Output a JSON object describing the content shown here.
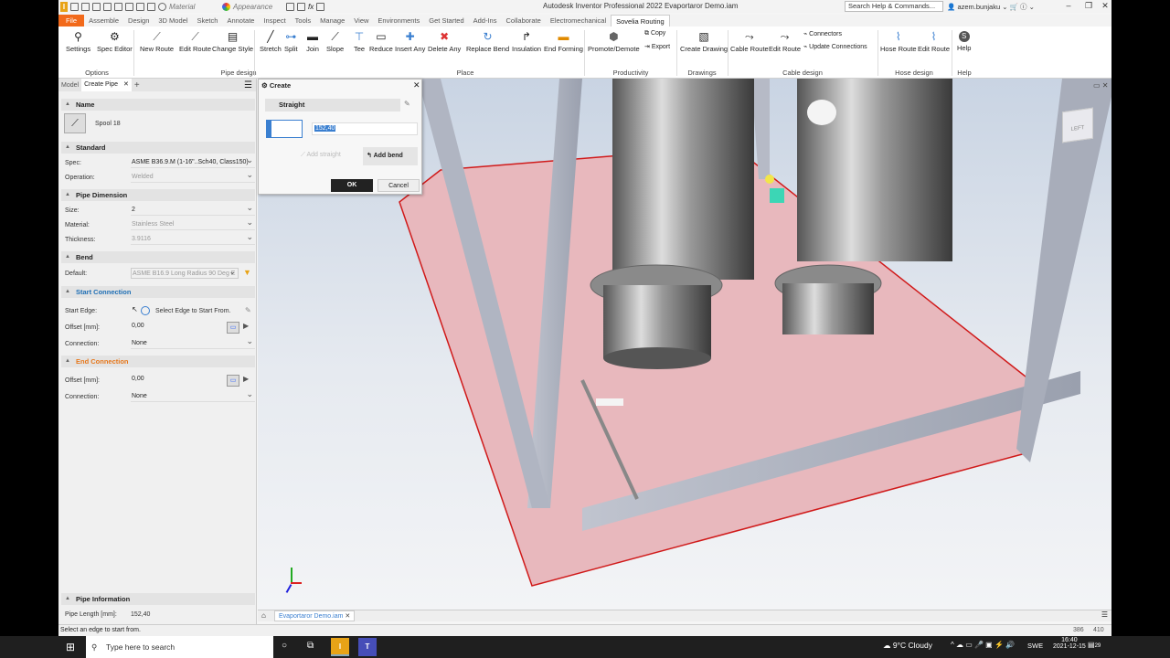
{
  "titlebar": {
    "material": "Material",
    "appearance": "Appearance",
    "title": "Autodesk Inventor Professional 2022   Evaportaror Demo.iam",
    "search_placeholder": "Search Help & Commands...",
    "user": "azem.bunjaku"
  },
  "menu_tabs": [
    "File",
    "Assemble",
    "Design",
    "3D Model",
    "Sketch",
    "Annotate",
    "Inspect",
    "Tools",
    "Manage",
    "View",
    "Environments",
    "Get Started",
    "Add-Ins",
    "Collaborate",
    "Electromechanical",
    "Sovelia Routing"
  ],
  "ribbon": {
    "settings": "Settings",
    "spec_editor": "Spec Editor",
    "options_group": "Options",
    "new_route": "New Route",
    "edit_route": "Edit Route",
    "change_style": "Change Style",
    "pipe_design_group": "Pipe design",
    "stretch": "Stretch",
    "split": "Split",
    "join": "Join",
    "slope": "Slope",
    "tee": "Tee",
    "reduce": "Reduce",
    "insert_any": "Insert Any",
    "delete_any": "Delete Any",
    "replace_bend": "Replace Bend",
    "insulation": "Insulation",
    "end_forming": "End Forming",
    "place_group": "Place",
    "promote_demote": "Promote/Demote",
    "copy": "Copy",
    "export": "Export",
    "productivity_group": "Productivity",
    "create_drawing": "Create Drawing",
    "drawings_group": "Drawings",
    "cable_route": "Cable Route",
    "edit_route2": "Edit Route",
    "connectors": "Connectors",
    "update_connections": "Update Connections",
    "cable_design_group": "Cable design",
    "hose_route": "Hose Route",
    "edit_route3": "Edit Route",
    "hose_design_group": "Hose design",
    "help": "Help",
    "help_group": "Help"
  },
  "panel": {
    "tab_model": "Model",
    "tab_create": "Create Pipe",
    "name_section": "Name",
    "spool": "Spool 18",
    "standard_section": "Standard",
    "spec_label": "Spec:",
    "spec_value": "ASME B36.9.M (1-16\"..Sch40, Class150)",
    "operation_label": "Operation:",
    "operation_value": "Welded",
    "pipe_dim_section": "Pipe Dimension",
    "size_label": "Size:",
    "size_value": "2",
    "material_label": "Material:",
    "material_value": "Stainless Steel",
    "thickness_label": "Thickness:",
    "thickness_value": "3.9116",
    "bend_section": "Bend",
    "default_label": "Default:",
    "default_value": "ASME B16.9 Long Radius 90 Deg E",
    "start_section": "Start Connection",
    "start_edge_label": "Start Edge:",
    "start_edge_value": "Select Edge to Start From.",
    "offset_label": "Offset [mm]:",
    "offset_value": "0,00",
    "connection_label": "Connection:",
    "connection_value": "None",
    "end_section": "End Connection",
    "end_offset_label": "Offset [mm]:",
    "end_offset_value": "0,00",
    "end_connection_label": "Connection:",
    "end_connection_value": "None",
    "pipe_info_section": "Pipe Information",
    "pipe_length_label": "Pipe Length [mm]:",
    "pipe_length_value": "152,40"
  },
  "dialog": {
    "title": "Create",
    "mode": "Straight",
    "length_value": "152,40",
    "add_straight": "Add straight",
    "add_bend": "Add bend",
    "ok": "OK",
    "cancel": "Cancel"
  },
  "doc_tab": "Evaportaror Demo.iam",
  "status": {
    "message": "Select an edge to start from.",
    "n1": "386",
    "n2": "410"
  },
  "taskbar": {
    "search_placeholder": "Type here to search",
    "weather": "9°C  Cloudy",
    "lang": "SWE",
    "time": "16:40",
    "date": "2021-12-15",
    "notif": "29"
  },
  "viewcube_label": "LEFT"
}
